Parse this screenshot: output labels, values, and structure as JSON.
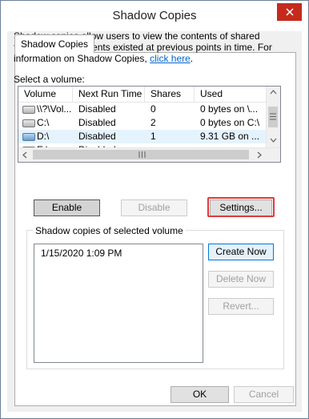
{
  "window": {
    "title": "Shadow Copies"
  },
  "tabs": [
    {
      "label": "Shadow Copies"
    }
  ],
  "description": {
    "text": "Shadow copies allow users to view the contents of shared folders as the contents existed at previous points in time. For information on Shadow Copies,",
    "link": "click here",
    "end": "."
  },
  "volumes": {
    "label": "Select a volume:",
    "columns": [
      "Volume",
      "Next Run Time",
      "Shares",
      "Used"
    ],
    "rows": [
      {
        "volume": "\\\\?\\Vol...",
        "next_run": "Disabled",
        "shares": "0",
        "used": "0 bytes on \\...",
        "icon": "drive-icon",
        "selected": false
      },
      {
        "volume": "C:\\",
        "next_run": "Disabled",
        "shares": "2",
        "used": "0 bytes on C:\\",
        "icon": "drive-icon",
        "selected": false
      },
      {
        "volume": "D:\\",
        "next_run": "Disabled",
        "shares": "1",
        "used": "9.31 GB on ...",
        "icon": "drive-icon-blue",
        "selected": true
      },
      {
        "volume": "E:\\",
        "next_run": "Disabled",
        "shares": "",
        "used": "",
        "icon": "drive-icon",
        "selected": false
      }
    ]
  },
  "buttons": {
    "enable": "Enable",
    "disable": "Disable",
    "settings": "Settings...",
    "create_now": "Create Now",
    "delete_now": "Delete Now",
    "revert": "Revert...",
    "ok": "OK",
    "cancel": "Cancel"
  },
  "shadow_copies": {
    "label": "Shadow copies of selected volume",
    "items": [
      "1/15/2020 1:09 PM"
    ]
  },
  "colors": {
    "highlight_border": "#e03a3a",
    "close_button": "#c42b1c"
  }
}
